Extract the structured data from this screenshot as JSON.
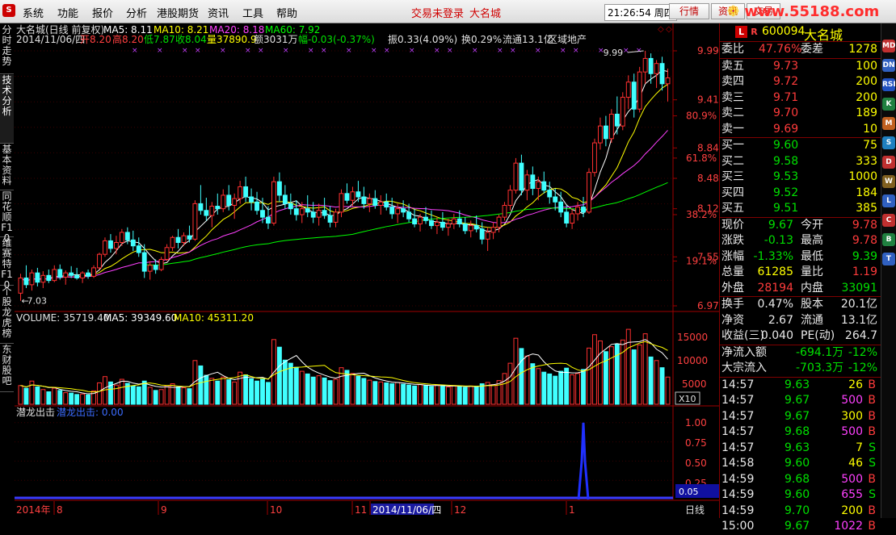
{
  "app_logo": "S",
  "menu": [
    "系统",
    "功能",
    "报价",
    "分析",
    "港股期货",
    "资讯",
    "工具",
    "帮助"
  ],
  "notice": "交易未登录",
  "notice_name": "大名城",
  "clock": "21:26:54 周四",
  "top_buttons": [
    "行情",
    "资讯",
    "交易"
  ],
  "brand": "www.55188.com",
  "left_tabs": [
    "分时走势",
    "技术分析",
    "基本资料",
    "同花顺F10",
    "维赛特F10",
    "个股龙虎榜",
    "东财股吧"
  ],
  "chart_header": {
    "title": "大名城(日线 前复权)",
    "ma": [
      {
        "label": "MA5: 8.11",
        "color": "#ffffff"
      },
      {
        "label": "MA10: 8.21",
        "color": "#ffff00"
      },
      {
        "label": "MA20: 8.18",
        "color": "#ff40ff"
      },
      {
        "label": "MA60: 7.92",
        "color": "#00ff00"
      }
    ],
    "info_date": "2014/11/06/四",
    "info_open": "开8.20",
    "info_high": "高8.20",
    "info_low": "低7.87",
    "info_close": "收8.04",
    "info_vol": "量37890.9",
    "info_amt": "额3031万",
    "info_chg": "幅-0.03(-0.37%)",
    "info_amp": "振0.33(4.09%)",
    "info_turn": "换0.29%",
    "info_float": "流通13.1亿",
    "info_sector": "区域地产"
  },
  "price_axis": [
    {
      "v": "9.99",
      "c": "#ff4040"
    },
    {
      "v": "9.41",
      "c": "#ff4040"
    },
    {
      "v": "80.9%",
      "c": "#ff4040"
    },
    {
      "v": "8.84",
      "c": "#ff4040"
    },
    {
      "v": "61.8%",
      "c": "#ff4040"
    },
    {
      "v": "8.48",
      "c": "#ff4040"
    },
    {
      "v": "8.12",
      "c": "#ff4040"
    },
    {
      "v": "38.2%",
      "c": "#ff4040"
    },
    {
      "v": "7.55",
      "c": "#ff4040"
    },
    {
      "v": "19.1%",
      "c": "#ff4040"
    },
    {
      "v": "6.97",
      "c": "#ff4040"
    }
  ],
  "high_label": "9.99",
  "low_label": "7.03",
  "volume_header": {
    "label": "VOLUME: 35719.40",
    "ma5": "MA5: 39349.60",
    "ma10": "MA10: 45311.20"
  },
  "volume_axis": [
    "15000",
    "10000",
    "5000"
  ],
  "volume_unit": "X10",
  "indicator": {
    "name": "潜龙出击",
    "value": "潜龙出击: 0.00",
    "axis": [
      "1.00",
      "0.75",
      "0.50",
      "0.25"
    ],
    "current": "0.05"
  },
  "time_axis": [
    "2014年",
    "8",
    "9",
    "10",
    "11",
    "2014/11/06/四",
    "12",
    "1"
  ],
  "period_label": "日线",
  "chart_data": {
    "type": "candlestick",
    "title": "大名城(日线 前复权)",
    "ylim": [
      6.97,
      9.99
    ],
    "volume_ylim": [
      0,
      17000
    ],
    "candles": [
      {
        "o": 7.12,
        "h": 7.35,
        "l": 7.03,
        "c": 7.3,
        "v": 4200
      },
      {
        "o": 7.3,
        "h": 7.45,
        "l": 7.18,
        "c": 7.22,
        "v": 3600
      },
      {
        "o": 7.22,
        "h": 7.4,
        "l": 7.15,
        "c": 7.36,
        "v": 5200
      },
      {
        "o": 7.36,
        "h": 7.42,
        "l": 7.2,
        "c": 7.25,
        "v": 3900
      },
      {
        "o": 7.25,
        "h": 7.38,
        "l": 7.18,
        "c": 7.33,
        "v": 3300
      },
      {
        "o": 7.33,
        "h": 7.4,
        "l": 7.24,
        "c": 7.27,
        "v": 2800
      },
      {
        "o": 7.27,
        "h": 7.45,
        "l": 7.25,
        "c": 7.4,
        "v": 3600
      },
      {
        "o": 7.4,
        "h": 7.46,
        "l": 7.28,
        "c": 7.31,
        "v": 3100
      },
      {
        "o": 7.31,
        "h": 7.39,
        "l": 7.22,
        "c": 7.36,
        "v": 2600
      },
      {
        "o": 7.36,
        "h": 7.44,
        "l": 7.3,
        "c": 7.33,
        "v": 2500
      },
      {
        "o": 7.33,
        "h": 7.42,
        "l": 7.28,
        "c": 7.3,
        "v": 2200
      },
      {
        "o": 7.3,
        "h": 7.38,
        "l": 7.24,
        "c": 7.36,
        "v": 2300
      },
      {
        "o": 7.36,
        "h": 7.4,
        "l": 7.29,
        "c": 7.32,
        "v": 2100
      },
      {
        "o": 7.32,
        "h": 7.45,
        "l": 7.3,
        "c": 7.42,
        "v": 3000
      },
      {
        "o": 7.42,
        "h": 7.6,
        "l": 7.4,
        "c": 7.58,
        "v": 4800
      },
      {
        "o": 7.58,
        "h": 7.78,
        "l": 7.55,
        "c": 7.74,
        "v": 6200
      },
      {
        "o": 7.74,
        "h": 7.82,
        "l": 7.6,
        "c": 7.65,
        "v": 5000
      },
      {
        "o": 7.65,
        "h": 7.8,
        "l": 7.58,
        "c": 7.72,
        "v": 4300
      },
      {
        "o": 7.72,
        "h": 7.88,
        "l": 7.68,
        "c": 7.84,
        "v": 5600
      },
      {
        "o": 7.84,
        "h": 7.9,
        "l": 7.7,
        "c": 7.75,
        "v": 4700
      },
      {
        "o": 7.75,
        "h": 7.86,
        "l": 7.62,
        "c": 7.68,
        "v": 4100
      },
      {
        "o": 7.68,
        "h": 7.78,
        "l": 7.55,
        "c": 7.6,
        "v": 3900
      },
      {
        "o": 7.6,
        "h": 7.7,
        "l": 7.3,
        "c": 7.38,
        "v": 5200
      },
      {
        "o": 7.38,
        "h": 7.5,
        "l": 7.28,
        "c": 7.45,
        "v": 3800
      },
      {
        "o": 7.45,
        "h": 7.52,
        "l": 7.35,
        "c": 7.4,
        "v": 3100
      },
      {
        "o": 7.4,
        "h": 7.55,
        "l": 7.38,
        "c": 7.52,
        "v": 3300
      },
      {
        "o": 7.52,
        "h": 7.7,
        "l": 7.5,
        "c": 7.66,
        "v": 4200
      },
      {
        "o": 7.66,
        "h": 7.8,
        "l": 7.62,
        "c": 7.78,
        "v": 4600
      },
      {
        "o": 7.78,
        "h": 7.88,
        "l": 7.65,
        "c": 7.72,
        "v": 3900
      },
      {
        "o": 7.72,
        "h": 7.84,
        "l": 7.68,
        "c": 7.8,
        "v": 3700
      },
      {
        "o": 7.8,
        "h": 7.92,
        "l": 7.72,
        "c": 7.76,
        "v": 3500
      },
      {
        "o": 7.76,
        "h": 8.22,
        "l": 7.74,
        "c": 8.18,
        "v": 9800
      },
      {
        "o": 8.18,
        "h": 8.4,
        "l": 8.05,
        "c": 8.1,
        "v": 8600
      },
      {
        "o": 8.1,
        "h": 8.25,
        "l": 7.98,
        "c": 8.04,
        "v": 6500
      },
      {
        "o": 8.04,
        "h": 8.2,
        "l": 7.9,
        "c": 8.15,
        "v": 5800
      },
      {
        "o": 8.15,
        "h": 8.3,
        "l": 8.05,
        "c": 8.12,
        "v": 5200
      },
      {
        "o": 8.12,
        "h": 8.35,
        "l": 8.08,
        "c": 8.28,
        "v": 6100
      },
      {
        "o": 8.28,
        "h": 8.4,
        "l": 8.1,
        "c": 8.16,
        "v": 5500
      },
      {
        "o": 8.16,
        "h": 8.3,
        "l": 8.0,
        "c": 8.24,
        "v": 5000
      },
      {
        "o": 8.24,
        "h": 8.45,
        "l": 8.18,
        "c": 8.38,
        "v": 7200
      },
      {
        "o": 8.38,
        "h": 8.5,
        "l": 8.2,
        "c": 8.26,
        "v": 6600
      },
      {
        "o": 8.26,
        "h": 8.36,
        "l": 8.1,
        "c": 8.2,
        "v": 5700
      },
      {
        "o": 8.2,
        "h": 8.32,
        "l": 8.05,
        "c": 8.1,
        "v": 5200
      },
      {
        "o": 8.1,
        "h": 8.25,
        "l": 7.95,
        "c": 8.02,
        "v": 5600
      },
      {
        "o": 8.02,
        "h": 8.15,
        "l": 7.88,
        "c": 7.95,
        "v": 4900
      },
      {
        "o": 7.95,
        "h": 8.5,
        "l": 7.92,
        "c": 8.44,
        "v": 14500
      },
      {
        "o": 8.44,
        "h": 8.55,
        "l": 8.2,
        "c": 8.28,
        "v": 12800
      },
      {
        "o": 8.28,
        "h": 8.4,
        "l": 8.12,
        "c": 8.18,
        "v": 9900
      },
      {
        "o": 8.18,
        "h": 8.3,
        "l": 8.05,
        "c": 8.12,
        "v": 9200
      },
      {
        "o": 8.12,
        "h": 8.22,
        "l": 7.98,
        "c": 8.05,
        "v": 8300
      },
      {
        "o": 8.05,
        "h": 8.2,
        "l": 7.95,
        "c": 8.12,
        "v": 7400
      },
      {
        "o": 8.12,
        "h": 8.28,
        "l": 8.02,
        "c": 8.08,
        "v": 6800
      },
      {
        "o": 8.08,
        "h": 8.2,
        "l": 7.95,
        "c": 8.02,
        "v": 6100
      },
      {
        "o": 8.02,
        "h": 8.18,
        "l": 7.92,
        "c": 8.1,
        "v": 6400
      },
      {
        "o": 8.1,
        "h": 8.25,
        "l": 8.0,
        "c": 8.04,
        "v": 5900
      },
      {
        "o": 8.04,
        "h": 8.15,
        "l": 7.9,
        "c": 7.96,
        "v": 5300
      },
      {
        "o": 7.96,
        "h": 8.12,
        "l": 7.9,
        "c": 8.08,
        "v": 5600
      },
      {
        "o": 8.08,
        "h": 8.35,
        "l": 8.02,
        "c": 8.3,
        "v": 8200
      },
      {
        "o": 8.3,
        "h": 8.42,
        "l": 8.18,
        "c": 8.22,
        "v": 7600
      },
      {
        "o": 8.22,
        "h": 8.38,
        "l": 8.15,
        "c": 8.32,
        "v": 6900
      },
      {
        "o": 8.32,
        "h": 8.45,
        "l": 8.2,
        "c": 8.26,
        "v": 6300
      },
      {
        "o": 8.26,
        "h": 8.38,
        "l": 8.12,
        "c": 8.18,
        "v": 5800
      },
      {
        "o": 8.18,
        "h": 8.3,
        "l": 8.08,
        "c": 8.24,
        "v": 5400
      },
      {
        "o": 8.24,
        "h": 8.34,
        "l": 8.12,
        "c": 8.16,
        "v": 5100
      },
      {
        "o": 8.16,
        "h": 8.28,
        "l": 8.05,
        "c": 8.2,
        "v": 5000
      },
      {
        "o": 8.2,
        "h": 8.3,
        "l": 8.1,
        "c": 8.14,
        "v": 4800
      },
      {
        "o": 8.14,
        "h": 8.25,
        "l": 8.0,
        "c": 8.06,
        "v": 4600
      },
      {
        "o": 8.06,
        "h": 8.18,
        "l": 7.95,
        "c": 8.12,
        "v": 4900
      },
      {
        "o": 8.12,
        "h": 8.22,
        "l": 8.02,
        "c": 8.08,
        "v": 4500
      },
      {
        "o": 8.08,
        "h": 8.18,
        "l": 7.96,
        "c": 8.0,
        "v": 4300
      },
      {
        "o": 8.0,
        "h": 8.12,
        "l": 7.9,
        "c": 7.94,
        "v": 4100
      },
      {
        "o": 7.94,
        "h": 8.06,
        "l": 7.85,
        "c": 8.02,
        "v": 4400
      },
      {
        "o": 8.02,
        "h": 8.14,
        "l": 7.94,
        "c": 7.98,
        "v": 4200
      },
      {
        "o": 7.98,
        "h": 8.1,
        "l": 7.88,
        "c": 7.92,
        "v": 4000
      },
      {
        "o": 7.92,
        "h": 8.02,
        "l": 7.82,
        "c": 7.96,
        "v": 4300
      },
      {
        "o": 7.96,
        "h": 8.08,
        "l": 7.86,
        "c": 7.9,
        "v": 4100
      },
      {
        "o": 7.9,
        "h": 8.0,
        "l": 7.8,
        "c": 7.94,
        "v": 3900
      },
      {
        "o": 7.94,
        "h": 8.06,
        "l": 7.88,
        "c": 8.0,
        "v": 4200
      },
      {
        "o": 8.0,
        "h": 8.1,
        "l": 7.9,
        "c": 7.94,
        "v": 4000
      },
      {
        "o": 7.94,
        "h": 8.02,
        "l": 7.82,
        "c": 7.86,
        "v": 3800
      },
      {
        "o": 7.86,
        "h": 7.98,
        "l": 7.78,
        "c": 7.92,
        "v": 4100
      },
      {
        "o": 7.92,
        "h": 8.04,
        "l": 7.84,
        "c": 7.88,
        "v": 3900
      },
      {
        "o": 7.88,
        "h": 7.96,
        "l": 7.7,
        "c": 7.76,
        "v": 4600
      },
      {
        "o": 7.76,
        "h": 7.9,
        "l": 7.62,
        "c": 7.84,
        "v": 4900
      },
      {
        "o": 7.84,
        "h": 7.96,
        "l": 7.76,
        "c": 7.9,
        "v": 4400
      },
      {
        "o": 7.9,
        "h": 8.05,
        "l": 7.84,
        "c": 8.02,
        "v": 5300
      },
      {
        "o": 8.02,
        "h": 8.2,
        "l": 7.98,
        "c": 8.16,
        "v": 6900
      },
      {
        "o": 8.16,
        "h": 8.4,
        "l": 8.1,
        "c": 8.34,
        "v": 9200
      },
      {
        "o": 8.34,
        "h": 8.72,
        "l": 8.3,
        "c": 8.66,
        "v": 14800
      },
      {
        "o": 8.66,
        "h": 8.76,
        "l": 8.28,
        "c": 8.34,
        "v": 12500
      },
      {
        "o": 8.34,
        "h": 8.58,
        "l": 8.22,
        "c": 8.52,
        "v": 10800
      },
      {
        "o": 8.52,
        "h": 8.62,
        "l": 8.28,
        "c": 8.36,
        "v": 9100
      },
      {
        "o": 8.36,
        "h": 8.5,
        "l": 8.22,
        "c": 8.44,
        "v": 8000
      },
      {
        "o": 8.44,
        "h": 8.56,
        "l": 8.3,
        "c": 8.34,
        "v": 7200
      },
      {
        "o": 8.34,
        "h": 8.44,
        "l": 8.18,
        "c": 8.26,
        "v": 6800
      },
      {
        "o": 8.26,
        "h": 8.36,
        "l": 8.1,
        "c": 8.2,
        "v": 6300
      },
      {
        "o": 8.2,
        "h": 8.32,
        "l": 8.02,
        "c": 8.08,
        "v": 7400
      },
      {
        "o": 8.08,
        "h": 8.16,
        "l": 7.9,
        "c": 7.95,
        "v": 8100
      },
      {
        "o": 7.95,
        "h": 8.12,
        "l": 7.88,
        "c": 8.06,
        "v": 6600
      },
      {
        "o": 8.06,
        "h": 8.2,
        "l": 7.98,
        "c": 8.14,
        "v": 6900
      },
      {
        "o": 8.14,
        "h": 8.26,
        "l": 8.02,
        "c": 8.08,
        "v": 7800
      },
      {
        "o": 8.08,
        "h": 8.6,
        "l": 8.06,
        "c": 8.55,
        "v": 12600
      },
      {
        "o": 8.55,
        "h": 8.95,
        "l": 8.5,
        "c": 8.9,
        "v": 15600
      },
      {
        "o": 8.9,
        "h": 9.2,
        "l": 8.82,
        "c": 9.1,
        "v": 14200
      },
      {
        "o": 9.1,
        "h": 9.22,
        "l": 8.86,
        "c": 8.95,
        "v": 11800
      },
      {
        "o": 8.95,
        "h": 9.3,
        "l": 8.9,
        "c": 9.24,
        "v": 12900
      },
      {
        "o": 9.24,
        "h": 9.45,
        "l": 9.0,
        "c": 9.1,
        "v": 13500
      },
      {
        "o": 9.1,
        "h": 9.5,
        "l": 9.05,
        "c": 9.44,
        "v": 14400
      },
      {
        "o": 9.44,
        "h": 9.7,
        "l": 9.3,
        "c": 9.62,
        "v": 16800
      },
      {
        "o": 9.62,
        "h": 9.72,
        "l": 9.2,
        "c": 9.3,
        "v": 12200
      },
      {
        "o": 9.3,
        "h": 9.8,
        "l": 9.26,
        "c": 9.74,
        "v": 13300
      },
      {
        "o": 9.74,
        "h": 9.99,
        "l": 9.6,
        "c": 9.9,
        "v": 15800
      },
      {
        "o": 9.9,
        "h": 9.96,
        "l": 9.6,
        "c": 9.72,
        "v": 10600
      },
      {
        "o": 9.72,
        "h": 9.88,
        "l": 9.55,
        "c": 9.84,
        "v": 9800
      },
      {
        "o": 9.84,
        "h": 9.92,
        "l": 9.52,
        "c": 9.6,
        "v": 8200
      },
      {
        "o": 9.6,
        "h": 9.78,
        "l": 9.39,
        "c": 9.67,
        "v": 6100
      }
    ],
    "indicator_series": {
      "name": "潜龙出击",
      "spike_at_index": 100,
      "spike_value": 1.0,
      "ylim": [
        0,
        1.05
      ]
    }
  },
  "quote": {
    "marker": "L",
    "marker2": "R",
    "code": "600094",
    "name": "大名城",
    "webi_label": "委比",
    "webi": "47.76%",
    "weicha_label": "委差",
    "weicha": "1278",
    "asks": [
      {
        "label": "卖五",
        "price": "9.73",
        "vol": "100"
      },
      {
        "label": "卖四",
        "price": "9.72",
        "vol": "200"
      },
      {
        "label": "卖三",
        "price": "9.71",
        "vol": "200"
      },
      {
        "label": "卖二",
        "price": "9.70",
        "vol": "189"
      },
      {
        "label": "卖一",
        "price": "9.69",
        "vol": "10"
      }
    ],
    "bids": [
      {
        "label": "买一",
        "price": "9.60",
        "vol": "75"
      },
      {
        "label": "买二",
        "price": "9.58",
        "vol": "333"
      },
      {
        "label": "买三",
        "price": "9.53",
        "vol": "1000"
      },
      {
        "label": "买四",
        "price": "9.52",
        "vol": "184"
      },
      {
        "label": "买五",
        "price": "9.51",
        "vol": "385"
      }
    ],
    "stats": [
      {
        "l1": "现价",
        "v1": "9.67",
        "c1": "g",
        "l2": "今开",
        "v2": "9.78",
        "c2": "r"
      },
      {
        "l1": "涨跌",
        "v1": "-0.13",
        "c1": "g",
        "l2": "最高",
        "v2": "9.78",
        "c2": "r"
      },
      {
        "l1": "涨幅",
        "v1": "-1.33%",
        "c1": "g",
        "l2": "最低",
        "v2": "9.39",
        "c2": "g"
      },
      {
        "l1": "总量",
        "v1": "61285",
        "c1": "y",
        "l2": "量比",
        "v2": "1.19",
        "c2": "r"
      },
      {
        "l1": "外盘",
        "v1": "28194",
        "c1": "r",
        "l2": "内盘",
        "v2": "33091",
        "c2": "g"
      }
    ],
    "fin": [
      {
        "l1": "换手",
        "v1": "0.47%",
        "l2": "股本",
        "v2": "20.1亿"
      },
      {
        "l1": "净资",
        "v1": "2.67",
        "l2": "流通",
        "v2": "13.1亿"
      },
      {
        "l1": "收益(三)",
        "v1": "0.040",
        "l2": "PE(动)",
        "v2": "264.7"
      }
    ],
    "flow": [
      {
        "label": "净流入额",
        "value": "-694.1万",
        "pct": "-12%"
      },
      {
        "label": "大宗流入",
        "value": "-703.3万",
        "pct": "-12%"
      }
    ],
    "ticks": [
      {
        "t": "14:57",
        "p": "9.63",
        "v": "26",
        "s": "B",
        "vc": "y"
      },
      {
        "t": "14:57",
        "p": "9.67",
        "v": "500",
        "s": "B",
        "vc": "m"
      },
      {
        "t": "14:57",
        "p": "9.67",
        "v": "300",
        "s": "B",
        "vc": "y"
      },
      {
        "t": "14:57",
        "p": "9.68",
        "v": "500",
        "s": "B",
        "vc": "m"
      },
      {
        "t": "14:57",
        "p": "9.63",
        "v": "7",
        "s": "S",
        "vc": "y"
      },
      {
        "t": "14:58",
        "p": "9.60",
        "v": "46",
        "s": "S",
        "vc": "y"
      },
      {
        "t": "14:59",
        "p": "9.68",
        "v": "500",
        "s": "B",
        "vc": "m"
      },
      {
        "t": "14:59",
        "p": "9.60",
        "v": "655",
        "s": "S",
        "vc": "m"
      },
      {
        "t": "14:59",
        "p": "9.70",
        "v": "200",
        "s": "B",
        "vc": "y"
      },
      {
        "t": "15:00",
        "p": "9.67",
        "v": "1022",
        "s": "B",
        "vc": "m"
      }
    ]
  },
  "side_buttons": [
    "MD",
    "DN",
    "RSI",
    "K",
    "M",
    "S",
    "D",
    "W",
    "L",
    "C",
    "B",
    "T"
  ]
}
